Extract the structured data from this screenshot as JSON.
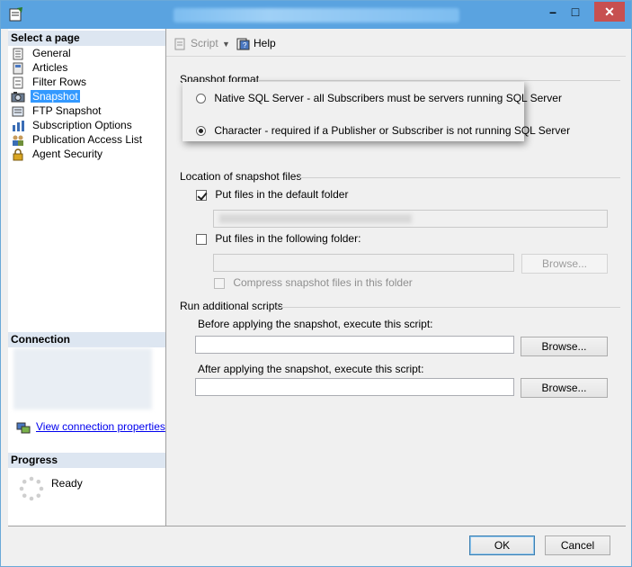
{
  "window": {
    "controls": {
      "minimize": "–",
      "maximize": "□",
      "close": "✕"
    }
  },
  "left": {
    "select_page_header": "Select a page",
    "items": [
      {
        "label": "General",
        "icon": "page-icon"
      },
      {
        "label": "Articles",
        "icon": "articles-icon"
      },
      {
        "label": "Filter Rows",
        "icon": "filter-icon"
      },
      {
        "label": "Snapshot",
        "icon": "snapshot-icon",
        "selected": true
      },
      {
        "label": "FTP Snapshot",
        "icon": "ftp-icon"
      },
      {
        "label": "Subscription Options",
        "icon": "options-icon"
      },
      {
        "label": "Publication Access List",
        "icon": "users-icon"
      },
      {
        "label": "Agent Security",
        "icon": "lock-icon"
      }
    ],
    "connection_header": "Connection",
    "view_connection": "View connection properties",
    "progress_header": "Progress",
    "progress_status": "Ready"
  },
  "toolbar": {
    "script_label": "Script",
    "help_label": "Help"
  },
  "snapshot_format": {
    "title": "Snapshot format",
    "native_option": "Native SQL Server - all Subscribers must be servers running SQL Server",
    "character_option": "Character - required if a Publisher or Subscriber is not running SQL Server",
    "selected": "character"
  },
  "location": {
    "title": "Location of snapshot files",
    "default_folder_label": "Put files in the default folder",
    "default_folder_checked": true,
    "following_folder_label": "Put files in the following folder:",
    "following_folder_checked": false,
    "browse_label": "Browse...",
    "compress_label": "Compress snapshot files in this folder"
  },
  "scripts": {
    "title": "Run additional scripts",
    "before_label": "Before applying the snapshot, execute this script:",
    "after_label": "After applying the snapshot, execute this script:",
    "browse_label": "Browse..."
  },
  "footer": {
    "ok_label": "OK",
    "cancel_label": "Cancel"
  },
  "colors": {
    "titlebar": "#5aa3e0",
    "selection": "#3399ff",
    "close": "#c75050"
  }
}
